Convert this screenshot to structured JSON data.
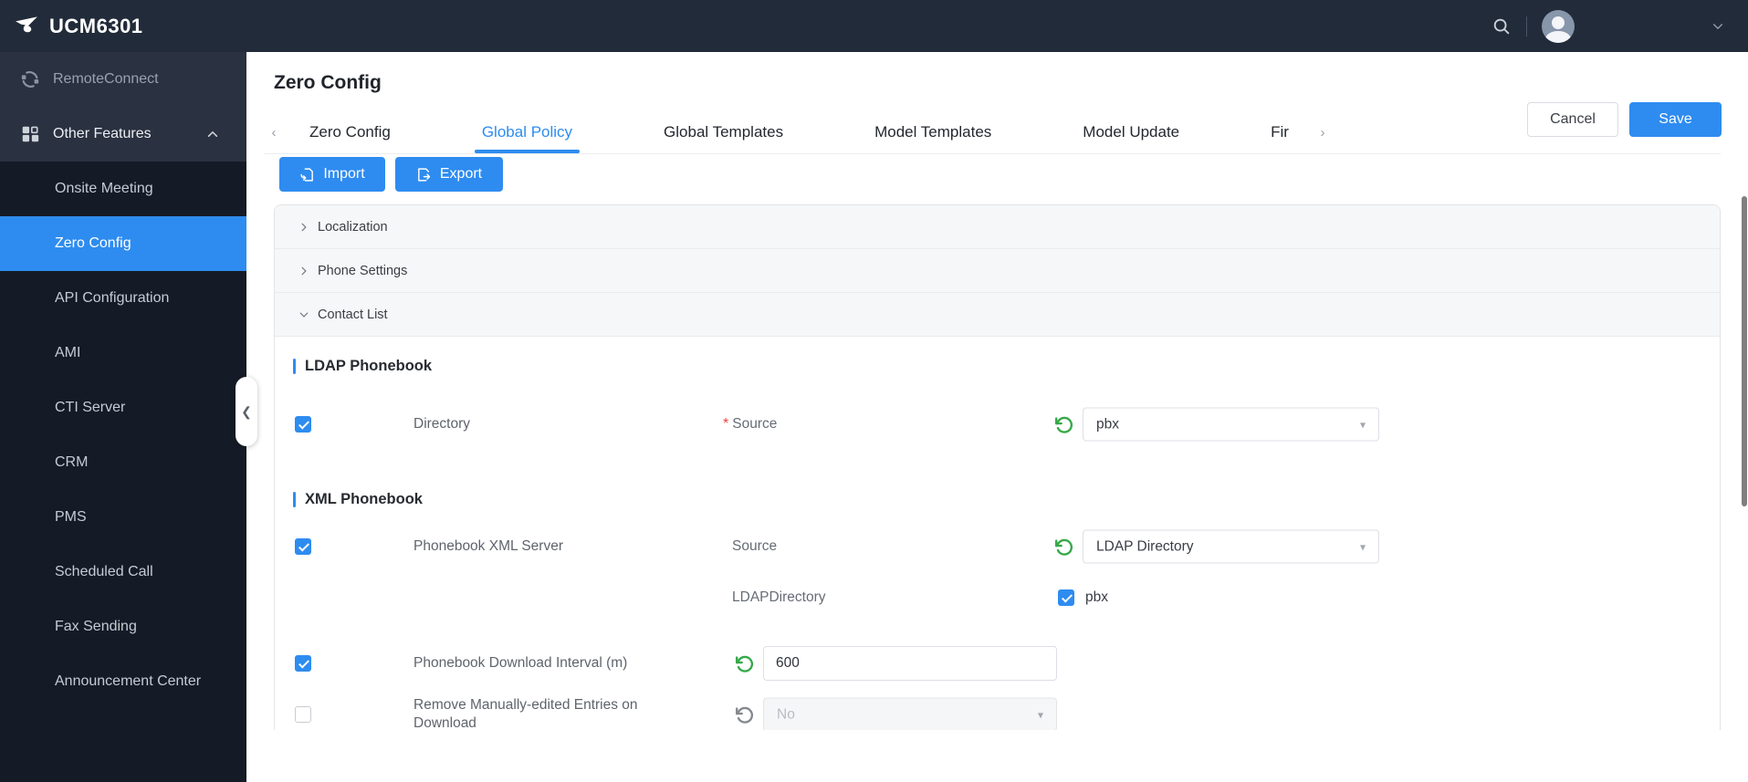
{
  "topbar": {
    "title": "UCM6301"
  },
  "sidebar": {
    "remote_connect": "RemoteConnect",
    "other_features": "Other Features",
    "submenu": [
      "Onsite Meeting",
      "Zero Config",
      "API Configuration",
      "AMI",
      "CTI Server",
      "CRM",
      "PMS",
      "Scheduled Call",
      "Fax Sending",
      "Announcement Center"
    ],
    "active_item": "Zero Config"
  },
  "page": {
    "title": "Zero Config",
    "cancel_label": "Cancel",
    "save_label": "Save"
  },
  "tabs": {
    "items": [
      "Zero Config",
      "Global Policy",
      "Global Templates",
      "Model Templates",
      "Model Update",
      "Fir"
    ],
    "active": "Global Policy"
  },
  "toolbar": {
    "import_label": "Import",
    "export_label": "Export"
  },
  "accordion": {
    "sections": [
      "Localization",
      "Phone Settings",
      "Contact List"
    ],
    "expanded": "Contact List"
  },
  "ldap_phonebook": {
    "title": "LDAP Phonebook",
    "directory_label": "Directory",
    "directory_checked": true,
    "required_marker": "*",
    "source_label": "Source",
    "source_value": "pbx"
  },
  "xml_phonebook": {
    "title": "XML Phonebook",
    "server_label": "Phonebook XML Server",
    "server_checked": true,
    "source_label": "Source",
    "source_value": "LDAP Directory",
    "ldap_directory_label": "LDAPDirectory",
    "ldap_directory_option": "pbx",
    "ldap_directory_option_checked": true,
    "interval_label": "Phonebook Download Interval (m)",
    "interval_checked": true,
    "interval_value": "600",
    "remove_label": "Remove Manually-edited Entries on Download",
    "remove_checked": false,
    "remove_value": "No",
    "remove_disabled": true
  },
  "colors": {
    "accent_blue": "#2e8cf0",
    "topbar_bg": "#222b39",
    "sidebar_bg": "#2a3140",
    "submenu_bg": "#151b26",
    "reset_active": "#36a849",
    "reset_disabled": "#85898f",
    "required_red": "#f03e3e"
  },
  "icons": {
    "logo": "grandstream-mark",
    "search": "magnifier",
    "user": "avatar-silhouette",
    "caret": "chevron-down",
    "remote_connect": "link-arcs",
    "other_features": "grid-squares",
    "import": "document-arrow-in",
    "export": "document-arrow-out",
    "reset": "rotate-ccw-arrow"
  }
}
